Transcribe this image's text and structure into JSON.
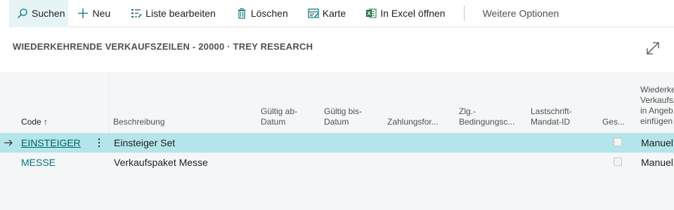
{
  "toolbar": {
    "search_label": "Suchen",
    "new_label": "Neu",
    "edit_list_label": "Liste bearbeiten",
    "delete_label": "Löschen",
    "card_label": "Karte",
    "excel_label": "In Excel öffnen",
    "more_label": "Weitere Optionen"
  },
  "page": {
    "title": "WIEDERKEHRENDE VERKAUFSZEILEN - 20000 · TREY RESEARCH"
  },
  "columns": {
    "code": "Code",
    "code_sort": "↑",
    "description": "Beschreibung",
    "valid_from": [
      "Gültig ab-",
      "Datum"
    ],
    "valid_to": [
      "Gültig bis-",
      "Datum"
    ],
    "payment_method": "Zahlungsfor...",
    "payment_terms": [
      "Zlg.-",
      "Bedingungsc..."
    ],
    "mandate": [
      "Lastschrift-",
      "Mandat-ID"
    ],
    "blocked": "Ges...",
    "insert": [
      "Wiederke",
      "Verkaufsz",
      "in Angeb",
      "einfügen"
    ]
  },
  "rows": [
    {
      "code": "EINSTEIGER",
      "description": "Einsteiger Set",
      "insert": "Manuel",
      "blocked": false,
      "selected": true
    },
    {
      "code": "MESSE",
      "description": "Verkaufspaket Messe",
      "insert": "Manuel",
      "blocked": false,
      "selected": false
    }
  ],
  "colors": {
    "accent": "#00767c",
    "selected_row": "#b4e5ea",
    "grid_bg": "#f5f6f7"
  }
}
